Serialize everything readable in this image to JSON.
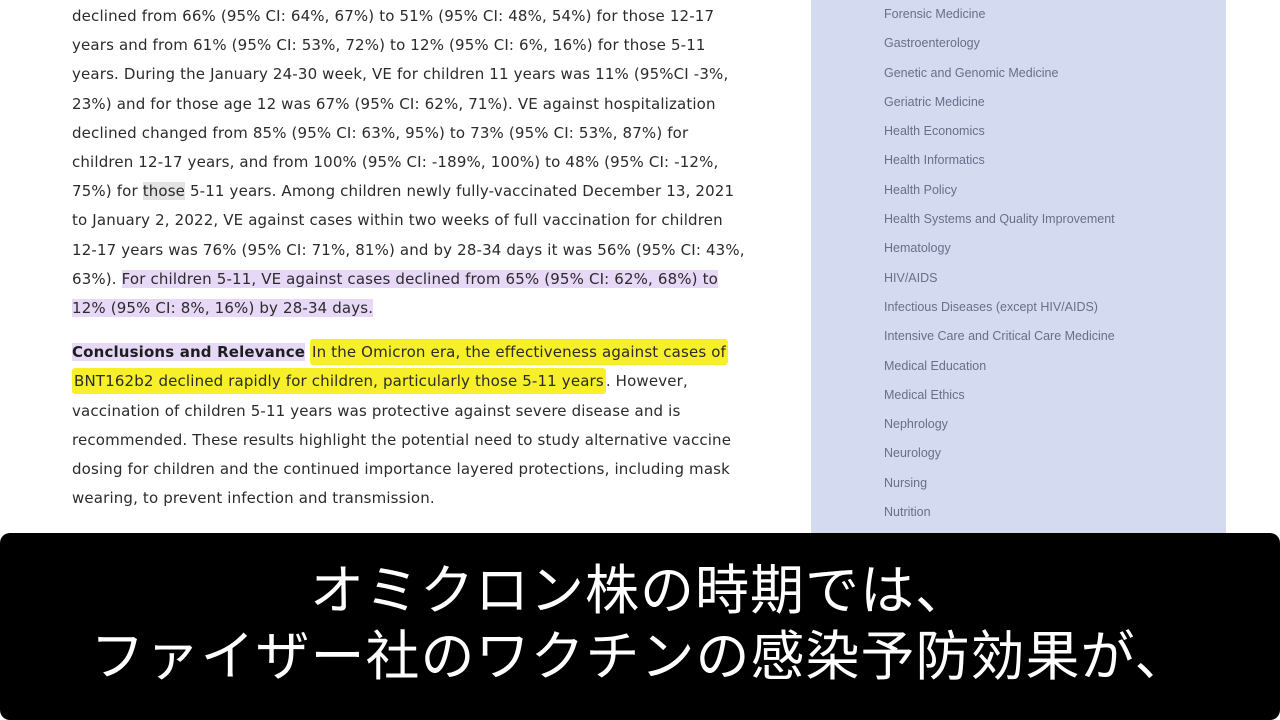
{
  "article": {
    "results_paragraph": [
      {
        "text": "declined from 66% (95% CI: 64%, 67%) to 51% (95% CI: 48%, 54%) for those 12-17 years and from 61% (95% CI: 53%, 72%) to 12% (95% CI: 6%, 16%) for those 5-11 years. During the January 24-30 week, VE for children 11 years was 11% (95%CI -3%, 23%) and for those age 12 was 67% (95% CI: 62%, 71%). VE against hospitalization declined changed from 85% (95% CI: 63%, 95%) to 73% (95% CI: 53%, 87%) for children 12-17 years, and from 100% (95% CI: -189%, 100%) to 48% (95% CI: -12%, 75%) for ",
        "style": "plain"
      },
      {
        "text": "those",
        "style": "gray"
      },
      {
        "text": " 5-11 years. Among children newly fully-vaccinated December 13, 2021 to January 2, 2022, VE against cases within two weeks of full vaccination for children 12-17 years was 76% (95% CI: 71%, 81%) and by 28-34 days it was 56% (95% CI: 43%, 63%). ",
        "style": "plain"
      },
      {
        "text": "For children 5-11, VE against cases declined from 65% (95% CI: 62%, 68%) to 12% (95% CI: 8%, 16%) by 28-34 days.",
        "style": "purple"
      }
    ],
    "conclusions_label": "Conclusions and Relevance",
    "conclusions_highlight": "In the Omicron era, the effectiveness against cases of BNT162b2 declined rapidly for children, particularly those 5-11 years",
    "conclusions_rest": ". However, vaccination of children 5-11 years was protective against severe disease and is recommended. These results highlight the potential need to study alternative vaccine dosing for children and the continued importance layered protections, including mask wearing, to prevent infection and transmission."
  },
  "sidebar": {
    "items": [
      "Forensic Medicine",
      "Gastroenterology",
      "Genetic and Genomic Medicine",
      "Geriatric Medicine",
      "Health Economics",
      "Health Informatics",
      "Health Policy",
      "Health Systems and Quality Improvement",
      "Hematology",
      "HIV/AIDS",
      "Infectious Diseases (except HIV/AIDS)",
      "Intensive Care and Critical Care Medicine",
      "Medical Education",
      "Medical Ethics",
      "Nephrology",
      "Neurology",
      "Nursing",
      "Nutrition"
    ]
  },
  "subtitle": {
    "line1": "オミクロン株の時期では、",
    "line2": "ファイザー社のワクチンの感染予防効果が、"
  },
  "colors": {
    "sidebar_bg": "#d4dbf0",
    "highlight_yellow": "#f6ef2a",
    "highlight_purple": "#e6d8f6",
    "subtitle_bg": "#000000"
  }
}
